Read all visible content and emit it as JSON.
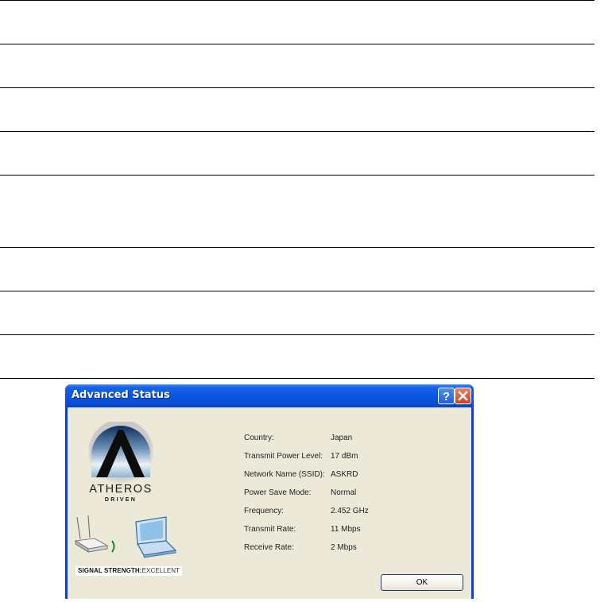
{
  "dialog": {
    "title": "Advanced Status",
    "help_icon": "question-mark-icon",
    "close_icon": "close-x-icon",
    "logo": {
      "brand": "ATHEROS",
      "tagline": "DRIVEN"
    },
    "signal": {
      "label": "SIGNAL STRENGTH:",
      "value": "EXCELLENT"
    },
    "info_rows": [
      {
        "label": "Country:",
        "value": "Japan"
      },
      {
        "label": "Transmit Power Level:",
        "value": "17 dBm"
      },
      {
        "label": "Network Name (SSID):",
        "value": "ASKRD"
      },
      {
        "label": "Power Save Mode:",
        "value": "Normal"
      },
      {
        "label": "Frequency:",
        "value": "2.452 GHz"
      },
      {
        "label": "Transmit Rate:",
        "value": "11 Mbps"
      },
      {
        "label": "Receive Rate:",
        "value": "2 Mbps"
      }
    ],
    "ok_label": "OK"
  },
  "colors": {
    "titlebar": "#0856df",
    "client_background": "#ece9d8",
    "close_button": "#c8411f"
  }
}
